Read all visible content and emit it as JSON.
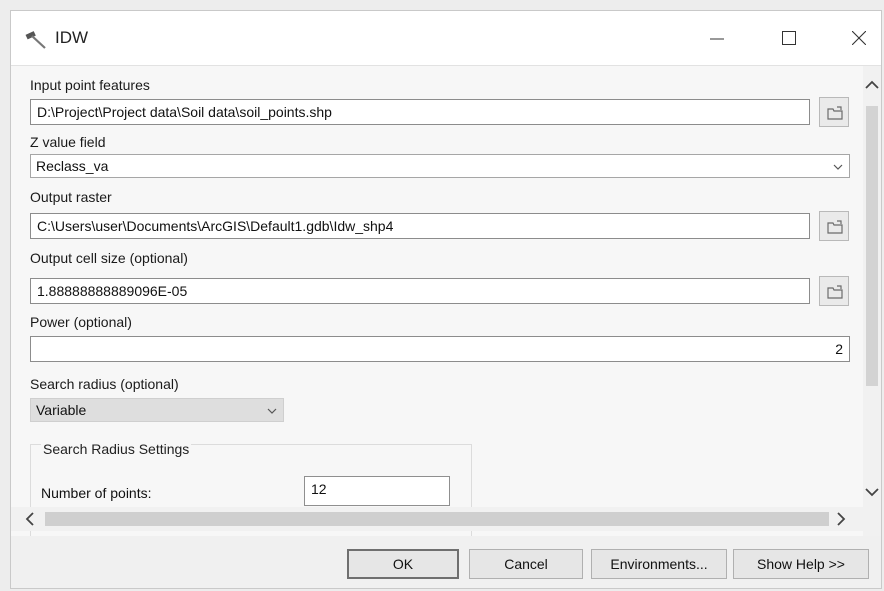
{
  "window": {
    "title": "IDW"
  },
  "form": {
    "input_point_features": {
      "label": "Input point features",
      "value": "D:\\Project\\Project data\\Soil data\\soil_points.shp"
    },
    "z_value_field": {
      "label": "Z value field",
      "value": "Reclass_va"
    },
    "output_raster": {
      "label": "Output raster",
      "value": "C:\\Users\\user\\Documents\\ArcGIS\\Default1.gdb\\Idw_shp4"
    },
    "output_cell_size": {
      "label": "Output cell size (optional)",
      "value": "1.88888888889096E-05"
    },
    "power": {
      "label": "Power (optional)",
      "value": "2"
    },
    "search_radius": {
      "label": "Search radius (optional)",
      "value": "Variable"
    },
    "search_radius_settings": {
      "title": "Search Radius Settings",
      "number_of_points_label": "Number of points:",
      "number_of_points_value": "12"
    }
  },
  "buttons": {
    "ok": "OK",
    "cancel": "Cancel",
    "environments": "Environments...",
    "show_help": "Show Help >>"
  },
  "icons": {
    "app": "hammer-icon",
    "minimize": "minimize-icon",
    "maximize": "maximize-icon",
    "close": "close-icon",
    "browse": "folder-browse-icon",
    "dropdown": "chevron-down-icon"
  }
}
